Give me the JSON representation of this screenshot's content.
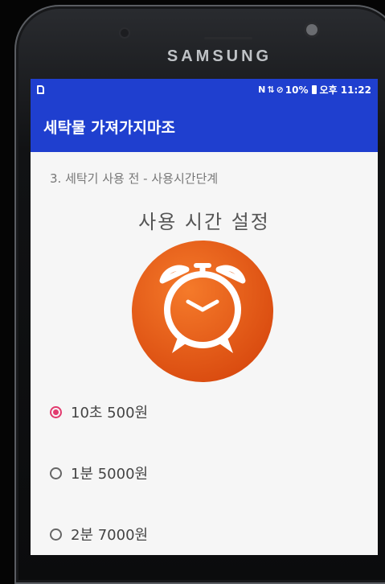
{
  "device": {
    "brand": "SAMSUNG"
  },
  "status_bar": {
    "icons_left": [
      "sd-card-icon"
    ],
    "nfc": "N",
    "battery_percent": "10%",
    "time": "오후 11:22",
    "icons_right": [
      "nfc-icon",
      "vibrate-icon",
      "alarm-icon",
      "battery-icon"
    ]
  },
  "app_bar": {
    "title": "세탁물 가져가지마조"
  },
  "content": {
    "step_text": "3. 세탁기 사용 전 - 사용시간단계",
    "heading": "사용 시간 설정",
    "image_icon": "alarm-clock-icon",
    "colors": {
      "accent": "#e23a6e",
      "clock": "#ee5a16",
      "bar": "#1f3fcf"
    }
  },
  "options": [
    {
      "label": "10초 500원",
      "checked": true
    },
    {
      "label": "1분 5000원",
      "checked": false
    },
    {
      "label": "2분 7000원",
      "checked": false
    }
  ]
}
